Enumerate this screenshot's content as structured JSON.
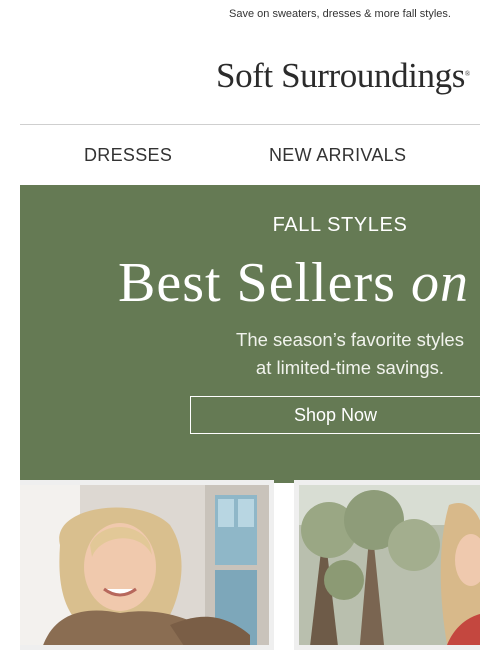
{
  "preheader": {
    "text": "Save on sweaters, dresses & more fall styles."
  },
  "logo": {
    "text": "Soft Surroundings",
    "mark": "®"
  },
  "nav": {
    "items": [
      {
        "label": "DRESSES"
      },
      {
        "label": "NEW ARRIVALS"
      }
    ]
  },
  "hero": {
    "eyebrow": "FALL STYLES",
    "headline_main": "Best Sellers ",
    "headline_italic": "on S",
    "subtitle_line1": "The season’s favorite styles",
    "subtitle_line2": "at limited-time savings.",
    "button_label": "Shop Now",
    "background_color": "#657a54"
  },
  "photos": [
    {
      "subject": "woman in sweater indoors",
      "icon": "product-photo"
    },
    {
      "subject": "woman outdoors with trees",
      "icon": "product-photo"
    }
  ]
}
